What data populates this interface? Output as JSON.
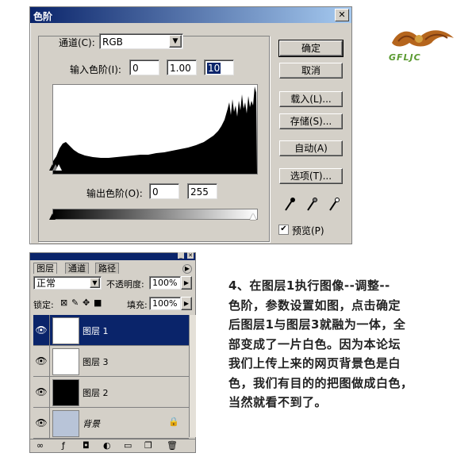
{
  "levels_dialog": {
    "title": "色阶",
    "close_icon": "close-icon",
    "channel_label": "通道(C):",
    "channel_value": "RGB",
    "input_levels_label": "输入色阶(I):",
    "input_black": "0",
    "input_gamma": "1.00",
    "input_white": "10",
    "output_levels_label": "输出色阶(O):",
    "output_black": "0",
    "output_white": "255",
    "buttons": {
      "ok": "确定",
      "cancel": "取消",
      "load": "载入(L)...",
      "save": "存储(S)...",
      "auto": "自动(A)",
      "options": "选项(T)..."
    },
    "preview_label": "预览(P)",
    "preview_checked": "✔"
  },
  "logo": {
    "text": "GFLJC"
  },
  "layers_panel": {
    "tabs": [
      "图层",
      "通道",
      "路径"
    ],
    "blend_mode": "正常",
    "opacity_label": "不透明度:",
    "opacity_value": "100%",
    "lock_label": "锁定:",
    "fill_label": "填充:",
    "fill_value": "100%",
    "layers": [
      {
        "name": "图层 1",
        "selected": true,
        "thumb": "#ffffff"
      },
      {
        "name": "图层 3",
        "selected": false,
        "thumb": "#ffffff"
      },
      {
        "name": "图层 2",
        "selected": false,
        "thumb": "#000000"
      },
      {
        "name": "背景",
        "selected": false,
        "thumb": "#b8c4d8"
      }
    ]
  },
  "description": [
    "4、在图层1执行图像--调整--",
    "色阶，参数设置如图，点击确定",
    "后图层1与图层3就融为一体，全",
    "部变成了一片白色。因为本论坛",
    "我们上传上来的网页背景色是白",
    "色，我们有目的的把图做成白色，",
    "当然就看不到了。"
  ]
}
